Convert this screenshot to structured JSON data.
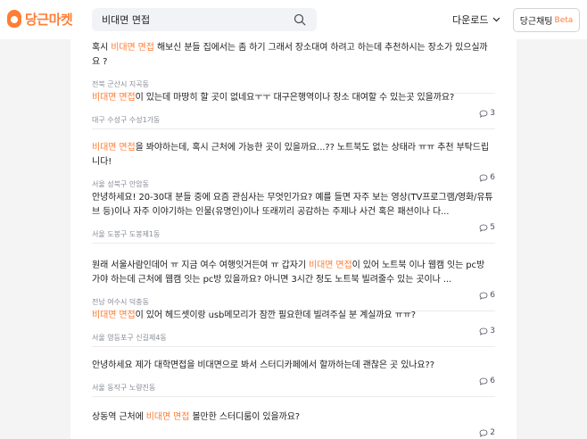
{
  "header": {
    "logo_text": "당근마켓",
    "search_value": "비대면 면접",
    "download_label": "다운로드",
    "chat_label": "당근채팅",
    "beta_label": "Beta"
  },
  "colors": {
    "brand": "#ff7e36",
    "text": "#212124",
    "muted": "#868b94",
    "background": "#f4f4f4"
  },
  "posts": [
    {
      "title": [
        {
          "t": "혹시 ",
          "hl": false
        },
        {
          "t": "비대면 면접",
          "hl": true
        },
        {
          "t": " 해보신 분들 집에서는 좀 하기 그래서 장소대여 하려고 하는데 추천하시는 장소가 있으실까요 ?",
          "hl": false
        }
      ],
      "location": "전북 군산시 지곡동",
      "comments": ""
    },
    {
      "title": [
        {
          "t": "비대면 면접",
          "hl": true
        },
        {
          "t": "이 있는데 마땅히 할 곳이 없네요ㅜㅜ 대구은행역이나 장소 대여할 수 있는곳 있을까요?",
          "hl": false
        }
      ],
      "location": "대구 수성구 수성1가동",
      "comments": "3"
    },
    {
      "title": [
        {
          "t": "비대면 면접",
          "hl": true
        },
        {
          "t": "을 봐야하는데, 혹시 근처에 가능한 곳이 있을까요...?? 노트북도 없는 상태라 ㅠㅠ 추천 부탁드립니다!",
          "hl": false
        }
      ],
      "location": "서울 성북구 안암동",
      "comments": "6"
    },
    {
      "title": [
        {
          "t": "안녕하세요! 20-30대 분들 중에 요즘 관심사는 무엇인가요? 예를 들면 자주 보는 영상(TV프로그램/영화/유튜브 등)이나 자주 이야기하는 인물(유명인)이나 또래끼리 공감하는 주제나 사건 혹은 패션이나 다...",
          "hl": false
        }
      ],
      "location": "서울 도봉구 도봉제1동",
      "comments": "5"
    },
    {
      "title": [
        {
          "t": "원래 서울사람인데어 ㅠ 지금 여수 여행잇거든여 ㅠ 갑자기 ",
          "hl": false
        },
        {
          "t": "비대면 면접",
          "hl": true
        },
        {
          "t": "이 있어 노트북 이나 웹캠 잇는 pc방 가야 하는데 근처에 웹캠 잇는 pc방 있을까요? 아니면 3시간 정도 노트북 빌려줄수 있는 곳이나 ...",
          "hl": false
        }
      ],
      "location": "전남 여수시 덕충동",
      "comments": "6"
    },
    {
      "title": [
        {
          "t": "비대면 면접",
          "hl": true
        },
        {
          "t": "이 있어 헤드셋이랑 usb메모리가 잠깐 필요한데 빌려주실 분 계실까요 ㅠㅠ?",
          "hl": false
        }
      ],
      "location": "서울 영등포구 신길제4동",
      "comments": "3"
    },
    {
      "title": [
        {
          "t": "안녕하세요 제가 대학면접을 비대면으로 봐서 스터디카페에서 할까하는데 괜찮은 곳 있나요??",
          "hl": false
        }
      ],
      "location": "서울 동작구 노량진동",
      "comments": "6"
    },
    {
      "title": [
        {
          "t": "상동역 근처에 ",
          "hl": false
        },
        {
          "t": "비대면 면접",
          "hl": true
        },
        {
          "t": " 볼만한 스터디룸이 있을까요?",
          "hl": false
        }
      ],
      "location": "",
      "comments": "2"
    }
  ]
}
